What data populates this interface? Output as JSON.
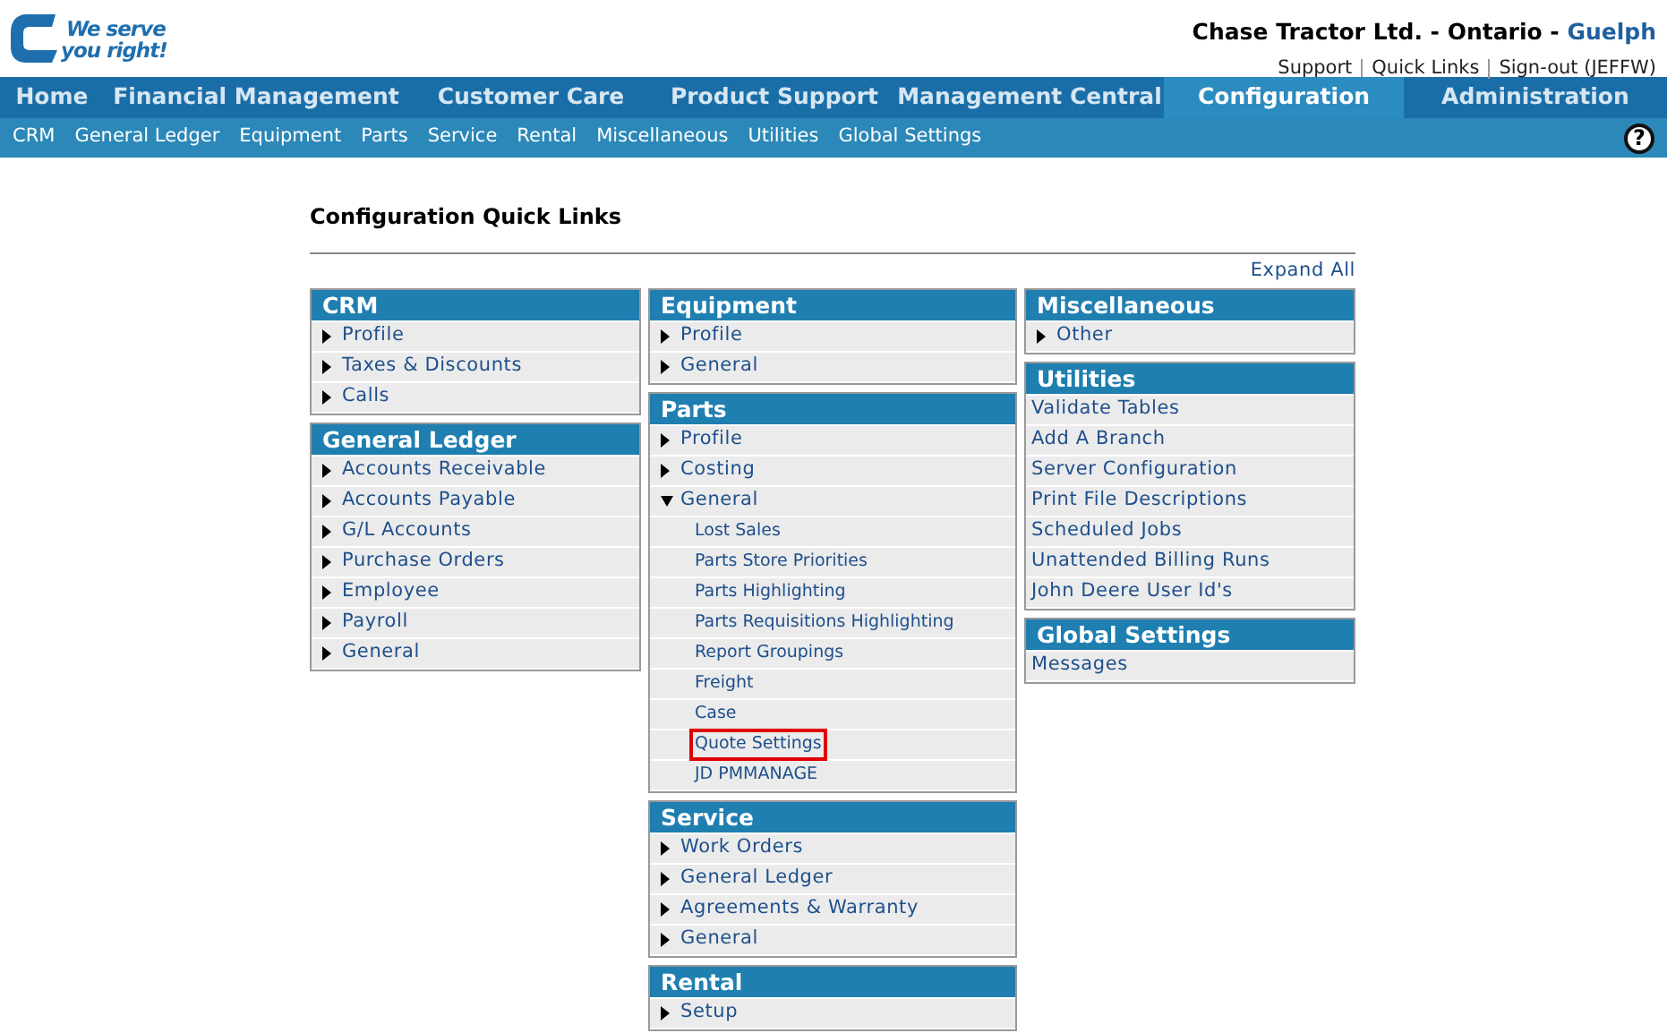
{
  "logo": {
    "tagline_1": "We serve",
    "tagline_2": "you right!"
  },
  "header": {
    "company": "Chase Tractor Ltd. - Ontario - ",
    "branch": "Guelph",
    "links": [
      "Support",
      "Quick Links",
      "Sign-out (JEFFW)"
    ]
  },
  "nav": [
    {
      "label": "Home",
      "selected": false
    },
    {
      "label": "Financial Management",
      "selected": false
    },
    {
      "label": "Customer Care",
      "selected": false
    },
    {
      "label": "Product Support",
      "selected": false
    },
    {
      "label": "Management Central",
      "selected": false
    },
    {
      "label": "Configuration",
      "selected": true
    },
    {
      "label": "Administration",
      "selected": false
    }
  ],
  "subnav": [
    "CRM",
    "General Ledger",
    "Equipment",
    "Parts",
    "Service",
    "Rental",
    "Miscellaneous",
    "Utilities",
    "Global Settings"
  ],
  "help": "?",
  "title": "Configuration Quick Links",
  "expand_all": "Expand All",
  "columns": [
    [
      {
        "title": "CRM",
        "items": [
          {
            "kind": "arrow",
            "label": "Profile",
            "expanded": false
          },
          {
            "kind": "arrow",
            "label": "Taxes & Discounts",
            "expanded": false
          },
          {
            "kind": "arrow",
            "label": "Calls",
            "expanded": false
          }
        ]
      },
      {
        "title": "General Ledger",
        "items": [
          {
            "kind": "arrow",
            "label": "Accounts Receivable",
            "expanded": false
          },
          {
            "kind": "arrow",
            "label": "Accounts Payable",
            "expanded": false
          },
          {
            "kind": "arrow",
            "label": "G/L Accounts",
            "expanded": false
          },
          {
            "kind": "arrow",
            "label": "Purchase Orders",
            "expanded": false
          },
          {
            "kind": "arrow",
            "label": "Employee",
            "expanded": false
          },
          {
            "kind": "arrow",
            "label": "Payroll",
            "expanded": false
          },
          {
            "kind": "arrow",
            "label": "General",
            "expanded": false
          }
        ]
      }
    ],
    [
      {
        "title": "Equipment",
        "items": [
          {
            "kind": "arrow",
            "label": "Profile",
            "expanded": false
          },
          {
            "kind": "arrow",
            "label": "General",
            "expanded": false
          }
        ]
      },
      {
        "title": "Parts",
        "items": [
          {
            "kind": "arrow",
            "label": "Profile",
            "expanded": false
          },
          {
            "kind": "arrow",
            "label": "Costing",
            "expanded": false
          },
          {
            "kind": "arrow",
            "label": "General",
            "expanded": true,
            "children": [
              {
                "label": "Lost Sales",
                "outlined": false
              },
              {
                "label": "Parts Store Priorities",
                "outlined": false
              },
              {
                "label": "Parts Highlighting",
                "outlined": false
              },
              {
                "label": "Parts Requisitions Highlighting",
                "outlined": false
              },
              {
                "label": "Report Groupings",
                "outlined": false
              },
              {
                "label": "Freight",
                "outlined": false
              },
              {
                "label": "Case",
                "outlined": false
              },
              {
                "label": "Quote Settings",
                "outlined": true
              },
              {
                "label": "JD PMMANAGE",
                "outlined": false
              }
            ]
          }
        ]
      },
      {
        "title": "Service",
        "items": [
          {
            "kind": "arrow",
            "label": "Work Orders",
            "expanded": false
          },
          {
            "kind": "arrow",
            "label": "General Ledger",
            "expanded": false
          },
          {
            "kind": "arrow",
            "label": "Agreements & Warranty",
            "expanded": false
          },
          {
            "kind": "arrow",
            "label": "General",
            "expanded": false
          }
        ]
      },
      {
        "title": "Rental",
        "items": [
          {
            "kind": "arrow",
            "label": "Setup",
            "expanded": false
          }
        ]
      }
    ],
    [
      {
        "title": "Miscellaneous",
        "items": [
          {
            "kind": "arrow",
            "label": "Other",
            "expanded": false
          }
        ]
      },
      {
        "title": "Utilities",
        "items": [
          {
            "kind": "plain",
            "label": "Validate Tables"
          },
          {
            "kind": "plain",
            "label": "Add A Branch"
          },
          {
            "kind": "plain",
            "label": "Server Configuration"
          },
          {
            "kind": "plain",
            "label": "Print File Descriptions"
          },
          {
            "kind": "plain",
            "label": "Scheduled Jobs"
          },
          {
            "kind": "plain",
            "label": "Unattended Billing Runs"
          },
          {
            "kind": "plain",
            "label": "John Deere User Id's"
          }
        ]
      },
      {
        "title": "Global Settings",
        "items": [
          {
            "kind": "plain",
            "label": "Messages"
          }
        ]
      }
    ]
  ]
}
